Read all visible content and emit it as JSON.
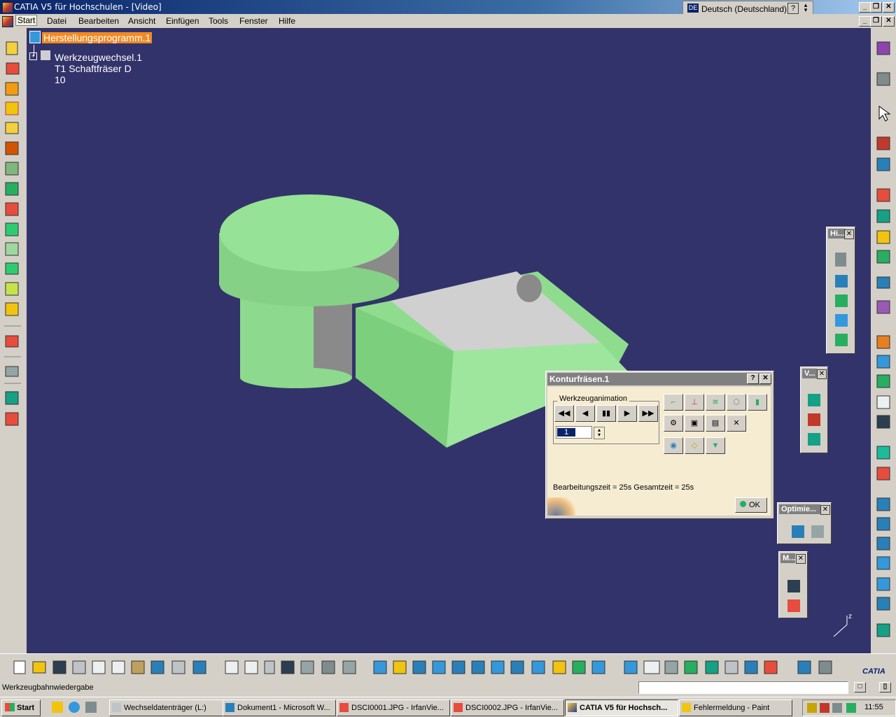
{
  "window": {
    "title": "CATIA V5 für Hochschulen - [Video]",
    "language_label": "Deutsch (Deutschland)",
    "language_code": "DE",
    "help_label": "?"
  },
  "menu": {
    "items": [
      "Start",
      "Datei",
      "Bearbeiten",
      "Ansicht",
      "Einfügen",
      "Tools",
      "Fenster",
      "Hilfe"
    ]
  },
  "tree": {
    "root": "Herstellungsprogramm.1",
    "child": "Werkzeugwechsel.1  T1 Schaftfräser D 10"
  },
  "floating_toolbars": {
    "hi": "Hi...",
    "v": "V...",
    "optimie": "Optimie...",
    "m": "M..."
  },
  "dialog": {
    "title": "Konturfräsen.1",
    "help": "?",
    "close": "✕",
    "group_label": "Werkzeuganimation",
    "frame_value": "1",
    "playback": [
      "◀◀",
      "◀",
      "▮▮",
      "▶",
      "▶▶"
    ],
    "time_text": "Bearbeitungszeit = 25s   Gesamtzeit = 25s",
    "ok_label": "OK"
  },
  "status": {
    "message": "Werkzeugbahnwiedergabe"
  },
  "taskbar": {
    "start": "Start",
    "tasks": [
      "Wechseldatenträger (L:)",
      "Dokument1 - Microsoft W...",
      "DSCI0001.JPG - IrfanVie...",
      "DSCI0002.JPG - IrfanVie...",
      "CATIA V5 für Hochsch...",
      "Fehlermeldung - Paint"
    ],
    "clock": "11:55"
  },
  "colors": {
    "viewport_bg": "#33336b",
    "part_green": "#8fe08f",
    "part_grey": "#8a8a8a",
    "tree_highlight": "#f08a24"
  }
}
